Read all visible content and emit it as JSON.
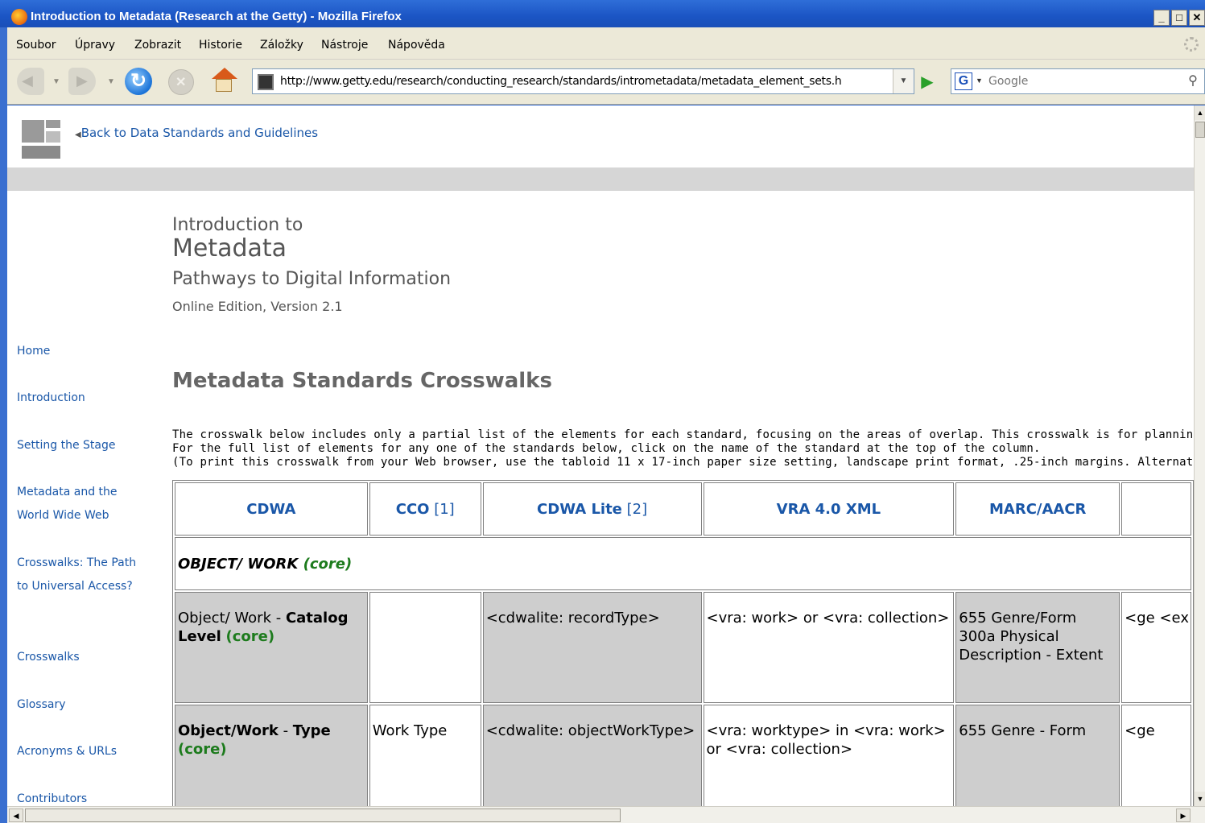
{
  "window": {
    "title": "Introduction to Metadata (Research at the Getty) - Mozilla Firefox",
    "minimize": "_",
    "maximize": "Ɛ",
    "close": "X"
  },
  "menu": [
    "Soubor",
    "Úpravy",
    "Zobrazit",
    "Historie",
    "Záložky",
    "Nástroje",
    "Nápověda"
  ],
  "url": "http://www.getty.edu/research/conducting_research/standards/intrometadata/metadata_element_sets.h",
  "search": {
    "placeholder": "Google"
  },
  "page": {
    "back_link": "Back to Data Standards and Guidelines",
    "header": {
      "line1": "Introduction to",
      "line2": "Metadata",
      "line3": "Pathways to Digital Information",
      "line4": "Online Edition, Version 2.1"
    },
    "nav": [
      "Home",
      "Introduction",
      "Setting the Stage",
      "Metadata and the World Wide Web",
      "Crosswalks: The Path to Universal Access?",
      "Crosswalks",
      "Glossary",
      "Acronyms & URLs",
      "Contributors"
    ],
    "section_title": "Metadata Standards Crosswalks",
    "intro": [
      "The crosswalk below includes only a partial list of the elements for each standard, focusing on the areas of overlap. This crosswalk is for planning purposes",
      "For the full list of elements for any one of the standards below, click on the name of the standard at the top of the column.",
      "(To print this crosswalk from your Web browser, use the tabloid 11 x 17-inch paper size setting, landscape print format, .25-inch margins. Alternatively, pri"
    ],
    "table": {
      "headers": [
        {
          "name": "CDWA",
          "note": ""
        },
        {
          "name": "CCO",
          "note": "[1]"
        },
        {
          "name": "CDWA Lite",
          "note": "[2]"
        },
        {
          "name": "VRA 4.0 XML",
          "note": ""
        },
        {
          "name": "MARC/AACR",
          "note": ""
        }
      ],
      "group": {
        "label": "OBJECT/ WORK",
        "core": "(core)"
      },
      "row1": {
        "c1_pre": "Object/ Work - ",
        "c1_bold": "Catalog Level",
        "c1_core": "(core)",
        "c2": "",
        "c3": "<cdwalite: recordType>",
        "c4": "<vra: work> or <vra: collection>",
        "c5": "655 Genre/Form 300a Physical Description - Extent",
        "c6": "<ge <ex"
      },
      "row2": {
        "c1_bold1": "Object/Work",
        "c1_mid": " - ",
        "c1_bold2": "Type",
        "c1_core": "(core)",
        "c2": "Work Type",
        "c3": "<cdwalite: objectWorkType>",
        "c4": "<vra: worktype> in <vra: work> or <vra: collection>",
        "c5": "655 Genre - Form",
        "c6": "<ge"
      }
    }
  }
}
